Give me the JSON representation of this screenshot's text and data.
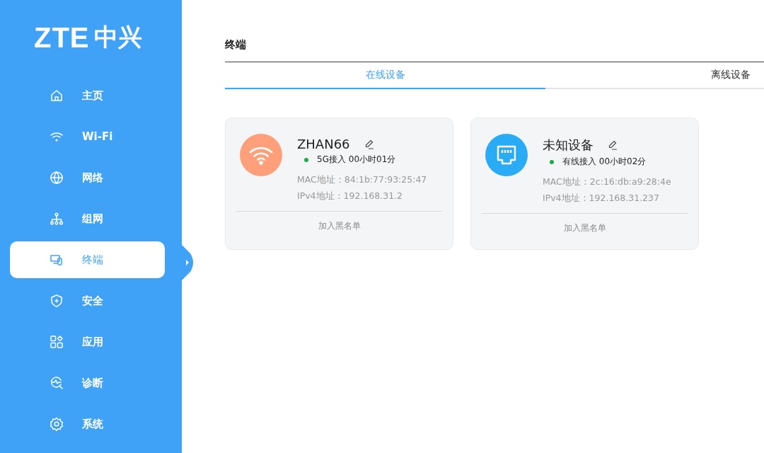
{
  "sidebar": {
    "logo": {
      "latin": "ZTE",
      "chinese": "中兴"
    },
    "items": [
      {
        "label": "主页",
        "selected": false
      },
      {
        "label": "Wi-Fi",
        "selected": false
      },
      {
        "label": "网络",
        "selected": false
      },
      {
        "label": "组网",
        "selected": false
      },
      {
        "label": "终端",
        "selected": true
      },
      {
        "label": "安全",
        "selected": false
      },
      {
        "label": "应用",
        "selected": false
      },
      {
        "label": "诊断",
        "selected": false
      },
      {
        "label": "系统",
        "selected": false
      }
    ]
  },
  "page": {
    "title": "终端",
    "tabs": [
      {
        "label": "在线设备",
        "selected": true
      },
      {
        "label": "离线设备",
        "selected": false
      }
    ],
    "devices": [
      {
        "kind": "wifi",
        "color": "#ffa07a",
        "name": "ZHAN66",
        "status": "5G接入 00小时01分",
        "mac": "MAC地址：84:1b:77:93:25:47",
        "ipv4": "IPv4地址：192.168.31.2",
        "action": "加入黑名单"
      },
      {
        "kind": "wired",
        "color": "#29abf5",
        "name": "未知设备",
        "status": "有线接入 00小时02分",
        "mac": "MAC地址：2c:16:db:a9:28:4e",
        "ipv4": "IPv4地址：192.168.31.237",
        "action": "加入黑名单"
      }
    ]
  }
}
